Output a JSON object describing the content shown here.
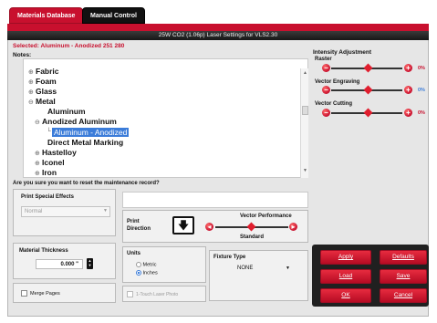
{
  "tabs": [
    {
      "label": "Materials Database",
      "active": true
    },
    {
      "label": "Manual Control",
      "active": false
    }
  ],
  "window_title": "25W CO2 (1.06p) Laser Settings for VLS2.30",
  "selected_label": "Selected: Aluminum - Anodized 251 280",
  "notes_label": "Notes:",
  "tree": [
    {
      "label": "Fabric",
      "expander": "⊕"
    },
    {
      "label": "Foam",
      "expander": "⊕"
    },
    {
      "label": "Glass",
      "expander": "⊕"
    },
    {
      "label": "Metal",
      "expander": "⊖"
    },
    {
      "label": "Aluminum",
      "expander": ""
    },
    {
      "label": "Anodized Aluminum",
      "expander": "⊖"
    },
    {
      "label": "Aluminum - Anodized",
      "expander": "",
      "selected": true
    },
    {
      "label": "Direct Metal Marking",
      "expander": ""
    },
    {
      "label": "Hastelloy",
      "expander": "⊕"
    },
    {
      "label": "Iconel",
      "expander": "⊕"
    },
    {
      "label": "Iron",
      "expander": "⊕"
    }
  ],
  "intensity": {
    "title": "Intensity Adjustment",
    "rows": [
      {
        "label": "Raster",
        "value": "0%",
        "level": 0.5
      },
      {
        "label": "Vector Engraving",
        "value": "0%",
        "level": 0.5
      },
      {
        "label": "Vector Cutting",
        "value": "0%",
        "level": 0.5
      }
    ]
  },
  "reset_question": "Are you sure you want to reset the maintenance record?",
  "print_effects": {
    "title": "Print Special Effects",
    "value": "Normal"
  },
  "print_direction": {
    "label": "Print Direction"
  },
  "vector_performance": {
    "title": "Vector Performance",
    "value": "Standard",
    "level": 0.5
  },
  "material_thickness": {
    "title": "Material Thickness",
    "value": "0.000 \""
  },
  "units": {
    "title": "Units",
    "options": [
      "Metric",
      "Inches"
    ],
    "selected": "Inches"
  },
  "fixture_type": {
    "title": "Fixture Type",
    "value": "NONE"
  },
  "merge_pages": {
    "label": "Merge Pages"
  },
  "one_touch": {
    "label": "1-Touch Laser Photo"
  },
  "buttons": {
    "apply": "Apply",
    "defaults": "Defaults",
    "load": "Load",
    "save": "Save",
    "ok": "OK",
    "cancel": "Cancel"
  },
  "colors": {
    "accent": "#c8102e",
    "selection": "#3b7cd9"
  },
  "icons": {
    "minus": "minus-circle-icon",
    "plus": "plus-circle-icon",
    "direction": "down-arrow-icon"
  }
}
